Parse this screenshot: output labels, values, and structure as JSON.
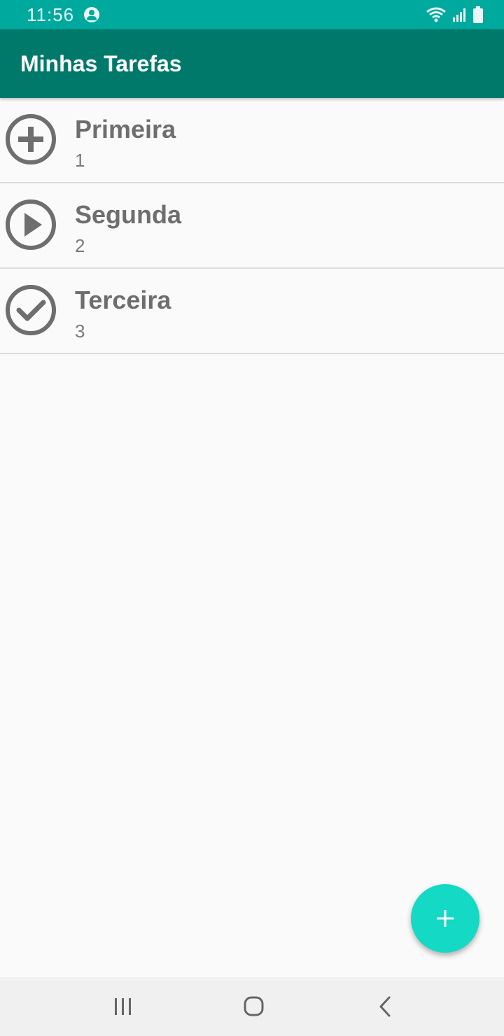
{
  "status_bar": {
    "time": "11:56",
    "icons": [
      "account-circle-icon",
      "wifi-icon",
      "signal-icon",
      "battery-icon"
    ]
  },
  "app_bar": {
    "title": "Minhas Tarefas",
    "color": "#00796b"
  },
  "tasks": [
    {
      "title": "Primeira",
      "subtitle": "1",
      "icon": "add-circle-icon"
    },
    {
      "title": "Segunda",
      "subtitle": "2",
      "icon": "play-circle-icon"
    },
    {
      "title": "Terceira",
      "subtitle": "3",
      "icon": "check-circle-icon"
    }
  ],
  "fab": {
    "icon": "plus-icon",
    "color": "#14d9c5"
  },
  "nav_bar": {
    "icons": [
      "recent-apps-icon",
      "home-icon",
      "back-icon"
    ]
  },
  "colors": {
    "status_bar": "#00a99d",
    "task_text": "#6e6e6e",
    "background": "#fafafa"
  }
}
